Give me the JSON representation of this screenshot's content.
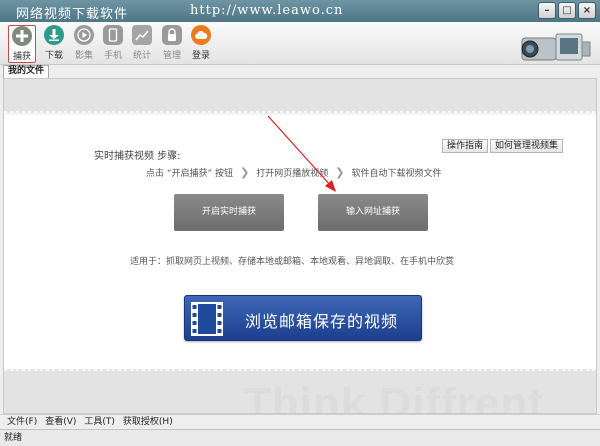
{
  "titlebar": {
    "title": "网络视频下载软件",
    "url": "http://www.leawo.cn",
    "minimize": "–",
    "maximize": "□",
    "close": "×"
  },
  "toolbar": {
    "items": [
      {
        "label": "捕获",
        "icon": "plus-icon"
      },
      {
        "label": "下载",
        "icon": "download-icon"
      },
      {
        "label": "影集",
        "icon": "play-icon"
      },
      {
        "label": "手机",
        "icon": "phone-icon"
      },
      {
        "label": "统计",
        "icon": "chart-icon"
      },
      {
        "label": "管理",
        "icon": "lock-icon"
      },
      {
        "label": "登录",
        "icon": "cloud-icon"
      }
    ]
  },
  "tabs": [
    {
      "label": "我的文件"
    }
  ],
  "main": {
    "guide_button": "操作指南",
    "manage_button": "如何管理视频集",
    "steps_title": "实时捕获视频 步骤:",
    "steps": [
      "点击 “开启捕获” 按钮",
      "打开网页播放视频",
      "软件自动下载视频文件"
    ],
    "start_capture_button": "开启实时捕获",
    "input_url_button": "输入网址捕获",
    "usage": "适用于：抓取网页上视频、存储本地或邮箱、本地观看、异地调取、在手机中欣赏",
    "browse_button": "浏览邮箱保存的视频",
    "watermark": "Think Diffrent"
  },
  "menubar": {
    "items": [
      "文件(F)",
      "查看(V)",
      "工具(T)",
      "获取授权(H)"
    ]
  },
  "status": {
    "text": "就绪"
  },
  "colors": {
    "titlebar": "#5f8697",
    "accent_blue": "#2a4f9f",
    "grey_button": "#7a7a7a",
    "red_arrow": "#e02020"
  }
}
